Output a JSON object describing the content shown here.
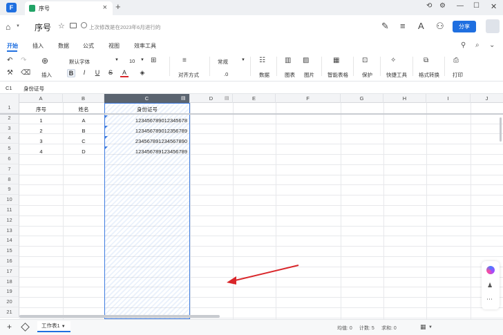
{
  "titlebar": {
    "tab_label": "序号",
    "close": "×",
    "add": "+",
    "logo": "F"
  },
  "docbar": {
    "title": "序号",
    "save_status": "上次修改是在2023年6月进行的",
    "share_label": "分享"
  },
  "menu": {
    "items": [
      "开始",
      "插入",
      "数据",
      "公式",
      "视图",
      "效率工具"
    ],
    "active": "开始"
  },
  "toolbar": {
    "insert_label": "插入",
    "font_family": "默认字体",
    "font_size": "10",
    "align_label": "对齐方式",
    "number_format": "常规",
    "decimal": ".0",
    "data_label": "数据",
    "chart_label": "图表",
    "picture_label": "图片",
    "smart_table_label": "智能表格",
    "protect_label": "保护",
    "quick_tools_label": "快捷工具",
    "format_convert_label": "格式转换",
    "print_label": "打印",
    "bold": "B",
    "italic": "I",
    "underline": "U",
    "strike": "S",
    "font_color": "A"
  },
  "formula_bar": {
    "cell_ref": "C1",
    "value": "身份证号"
  },
  "sheet": {
    "columns": [
      "A",
      "B",
      "C",
      "D",
      "E",
      "F",
      "G",
      "H",
      "I",
      "J"
    ],
    "selected_column": "C",
    "row_numbers": [
      "1",
      "2",
      "3",
      "4",
      "5",
      "6",
      "7",
      "8",
      "9",
      "10",
      "11",
      "12",
      "13",
      "14",
      "15",
      "16",
      "17",
      "18",
      "19",
      "20",
      "21"
    ],
    "headers": {
      "A": "序号",
      "B": "姓名",
      "C": "身份证号"
    },
    "rows": [
      {
        "a": "1",
        "b": "A",
        "c": "123456789012345678"
      },
      {
        "a": "2",
        "b": "B",
        "c": "123456789012356789"
      },
      {
        "a": "3",
        "b": "C",
        "c": "234567891234567890"
      },
      {
        "a": "4",
        "b": "D",
        "c": "123456789123456789"
      }
    ]
  },
  "statusbar": {
    "sheet_name": "工作表1",
    "average": "均值: 0",
    "count": "计数: 5",
    "sum": "求和: 0"
  },
  "colors": {
    "accent": "#1f6fe0",
    "selection": "#3d7be0",
    "arrow": "#d9262a"
  }
}
